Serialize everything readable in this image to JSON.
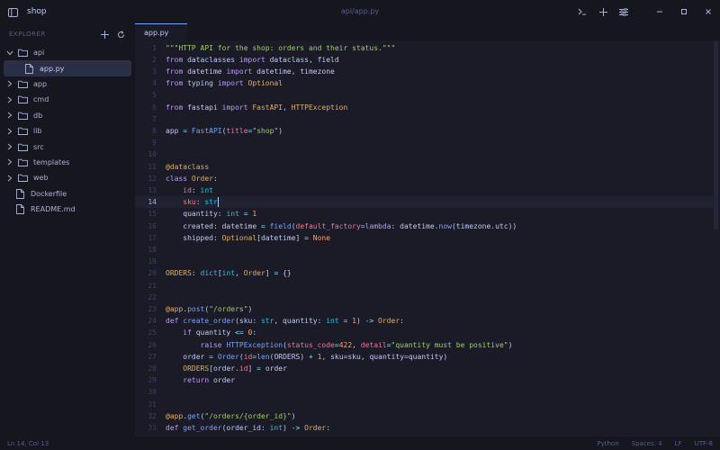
{
  "window": {
    "title": "shop",
    "path": "api/app.py"
  },
  "sidebar": {
    "header": "EXPLORER",
    "items": [
      {
        "label": "api",
        "type": "folder",
        "expanded": true
      },
      {
        "label": "app.py",
        "type": "file",
        "selected": true
      },
      {
        "label": "app",
        "type": "folder"
      },
      {
        "label": "cmd",
        "type": "folder"
      },
      {
        "label": "db",
        "type": "folder"
      },
      {
        "label": "lib",
        "type": "folder"
      },
      {
        "label": "src",
        "type": "folder"
      },
      {
        "label": "templates",
        "type": "folder"
      },
      {
        "label": "web",
        "type": "folder"
      },
      {
        "label": "Dockerfile",
        "type": "file"
      },
      {
        "label": "README.md",
        "type": "file"
      }
    ]
  },
  "tabs": [
    {
      "label": "app.py",
      "active": true
    }
  ],
  "editor": {
    "current_line": 14,
    "lines": [
      [
        [
          "s",
          "\"\"\"HTTP API for the shop: orders and their status.\"\"\""
        ]
      ],
      [
        [
          "k",
          "from "
        ],
        [
          "c",
          "dataclasses "
        ],
        [
          "k",
          "import "
        ],
        [
          "c",
          "dataclass, field"
        ]
      ],
      [
        [
          "k",
          "from "
        ],
        [
          "c",
          "datetime "
        ],
        [
          "k",
          "import "
        ],
        [
          "c",
          "datetime, timezone"
        ]
      ],
      [
        [
          "k",
          "from "
        ],
        [
          "c",
          "typing "
        ],
        [
          "k",
          "import "
        ],
        [
          "d",
          "Optional"
        ]
      ],
      [],
      [
        [
          "k",
          "from "
        ],
        [
          "c",
          "fastapi "
        ],
        [
          "k",
          "import "
        ],
        [
          "d",
          "FastAPI"
        ],
        [
          "c",
          ", "
        ],
        [
          "d",
          "HTTPException"
        ]
      ],
      [],
      [
        [
          "c",
          "app "
        ],
        [
          "p",
          "= "
        ],
        [
          "f",
          "FastAPI"
        ],
        [
          "c",
          "("
        ],
        [
          "r",
          "title"
        ],
        [
          "p",
          "="
        ],
        [
          "s",
          "\"shop\""
        ],
        [
          "c",
          ")"
        ]
      ],
      [],
      [],
      [
        [
          "d",
          "@dataclass"
        ]
      ],
      [
        [
          "k",
          "class "
        ],
        [
          "d",
          "Order"
        ],
        [
          "c",
          ":"
        ]
      ],
      [
        [
          "c",
          "    "
        ],
        [
          "r",
          "id"
        ],
        [
          "c",
          ": "
        ],
        [
          "t",
          "int"
        ]
      ],
      [
        [
          "c",
          "    "
        ],
        [
          "r",
          "sku"
        ],
        [
          "c",
          ": "
        ],
        [
          "t",
          "str"
        ]
      ],
      [
        [
          "c",
          "    quantity: "
        ],
        [
          "t",
          "int "
        ],
        [
          "p",
          "= "
        ],
        [
          "n",
          "1"
        ]
      ],
      [
        [
          "c",
          "    created: datetime "
        ],
        [
          "p",
          "= "
        ],
        [
          "f",
          "field"
        ],
        [
          "c",
          "("
        ],
        [
          "r",
          "default_factory"
        ],
        [
          "p",
          "="
        ],
        [
          "k",
          "lambda"
        ],
        [
          "c",
          ": datetime."
        ],
        [
          "f",
          "now"
        ],
        [
          "c",
          "(timezone.utc))"
        ]
      ],
      [
        [
          "c",
          "    shipped: "
        ],
        [
          "d",
          "Optional"
        ],
        [
          "c",
          "[datetime] "
        ],
        [
          "p",
          "= "
        ],
        [
          "n",
          "None"
        ]
      ],
      [],
      [],
      [
        [
          "d",
          "ORDERS"
        ],
        [
          "c",
          ": "
        ],
        [
          "t",
          "dict"
        ],
        [
          "c",
          "["
        ],
        [
          "t",
          "int"
        ],
        [
          "c",
          ", "
        ],
        [
          "d",
          "Order"
        ],
        [
          "c",
          "] "
        ],
        [
          "p",
          "= "
        ],
        [
          "c",
          "{}"
        ]
      ],
      [],
      [],
      [
        [
          "d",
          "@app"
        ],
        [
          "c",
          "."
        ],
        [
          "f",
          "post"
        ],
        [
          "c",
          "("
        ],
        [
          "s",
          "\"/orders\""
        ],
        [
          "c",
          ")"
        ]
      ],
      [
        [
          "k",
          "def "
        ],
        [
          "f",
          "create_order"
        ],
        [
          "c",
          "(sku: "
        ],
        [
          "t",
          "str"
        ],
        [
          "c",
          ", quantity: "
        ],
        [
          "t",
          "int "
        ],
        [
          "p",
          "= "
        ],
        [
          "n",
          "1"
        ],
        [
          "c",
          ") "
        ],
        [
          "p",
          "-> "
        ],
        [
          "d",
          "Order"
        ],
        [
          "c",
          ":"
        ]
      ],
      [
        [
          "c",
          "    "
        ],
        [
          "k",
          "if "
        ],
        [
          "c",
          "quantity "
        ],
        [
          "p",
          "<= "
        ],
        [
          "n",
          "0"
        ],
        [
          "c",
          ":"
        ]
      ],
      [
        [
          "c",
          "        "
        ],
        [
          "k",
          "raise "
        ],
        [
          "f",
          "HTTPException"
        ],
        [
          "c",
          "("
        ],
        [
          "r",
          "status_code"
        ],
        [
          "p",
          "="
        ],
        [
          "n",
          "422"
        ],
        [
          "c",
          ", "
        ],
        [
          "r",
          "detail"
        ],
        [
          "p",
          "="
        ],
        [
          "s",
          "\"quantity must be positive\""
        ],
        [
          "c",
          ")"
        ]
      ],
      [
        [
          "c",
          "    order "
        ],
        [
          "p",
          "= "
        ],
        [
          "f",
          "Order"
        ],
        [
          "c",
          "("
        ],
        [
          "r",
          "id"
        ],
        [
          "p",
          "="
        ],
        [
          "f",
          "len"
        ],
        [
          "c",
          "(ORDERS) "
        ],
        [
          "p",
          "+ "
        ],
        [
          "n",
          "1"
        ],
        [
          "c",
          ", sku"
        ],
        [
          "p",
          "="
        ],
        [
          "c",
          "sku, quantity"
        ],
        [
          "p",
          "="
        ],
        [
          "c",
          "quantity)"
        ]
      ],
      [
        [
          "c",
          "    "
        ],
        [
          "d",
          "ORDERS"
        ],
        [
          "c",
          "[order."
        ],
        [
          "r",
          "id"
        ],
        [
          "c",
          "] "
        ],
        [
          "p",
          "= "
        ],
        [
          "c",
          "order"
        ]
      ],
      [
        [
          "c",
          "    "
        ],
        [
          "k",
          "return "
        ],
        [
          "c",
          "order"
        ]
      ],
      [],
      [],
      [
        [
          "d",
          "@app"
        ],
        [
          "c",
          "."
        ],
        [
          "f",
          "get"
        ],
        [
          "c",
          "("
        ],
        [
          "s",
          "\"/orders/{order_id}\""
        ],
        [
          "c",
          ")"
        ]
      ],
      [
        [
          "k",
          "def "
        ],
        [
          "f",
          "get_order"
        ],
        [
          "c",
          "(order_id: "
        ],
        [
          "t",
          "int"
        ],
        [
          "c",
          ") "
        ],
        [
          "p",
          "-> "
        ],
        [
          "d",
          "Order"
        ],
        [
          "c",
          ":"
        ]
      ]
    ]
  },
  "status": {
    "position": "Ln 14, Col 13",
    "language": "Python",
    "indent": "Spaces: 4",
    "eol": "LF",
    "encoding": "UTF-8"
  },
  "colors": {
    "background": "#1a1b26",
    "panel": "#16161e",
    "accent": "#7aa2f7"
  }
}
